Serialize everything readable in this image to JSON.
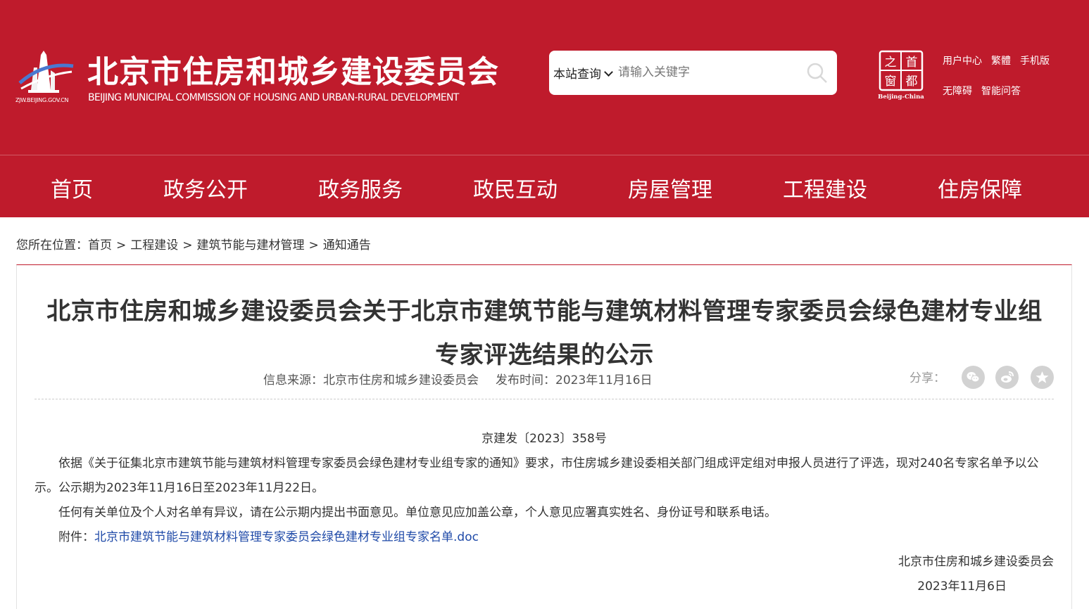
{
  "header": {
    "logo_url_text": "ZJW.BEIJING.GOV.CN",
    "site_title": "北京市住房和城乡建设委员会",
    "site_subtitle": "BEIJING MUNICIPAL COMMISSION OF HOUSING AND URBAN-RURAL DEVELOPMENT",
    "search": {
      "scope_label": "本站查询",
      "placeholder": "请输入关键字"
    },
    "capital_logo": {
      "chars": [
        "之",
        "首",
        "窗",
        "都"
      ],
      "caption": "Beijing-China"
    },
    "links_row1": [
      "用户中心",
      "繁體",
      "手机版"
    ],
    "links_row2": [
      "无障碍",
      "智能问答"
    ]
  },
  "nav": [
    "首页",
    "政务公开",
    "政务服务",
    "政民互动",
    "房屋管理",
    "工程建设",
    "住房保障"
  ],
  "breadcrumb": {
    "prefix": "您所在位置：",
    "items": [
      "首页",
      "工程建设",
      "建筑节能与建材管理",
      "通知通告"
    ],
    "separator": ">"
  },
  "article": {
    "title_line1": "北京市住房和城乡建设委员会关于北京市建筑节能与建筑材料管理专家委员会绿色建材专业组",
    "title_line2": "专家评选结果的公示",
    "source": "信息来源：北京市住房和城乡建设委员会",
    "publish_time": "发布时间：2023年11月16日",
    "share_label": "分享：",
    "share_icons": [
      "wechat-icon",
      "weibo-icon",
      "star-icon"
    ],
    "doc_number": "京建发〔2023〕358号",
    "paragraph1": "依据《关于征集北京市建筑节能与建筑材料管理专家委员会绿色建材专业组专家的通知》要求，市住房城乡建设委相关部门组成评定组对申报人员进行了评选，现对240名专家名单予以公示。公示期为2023年11月16日至2023年11月22日。",
    "paragraph2": "任何有关单位及个人对名单有异议，请在公示期内提出书面意见。单位意见应加盖公章，个人意见应署真实姓名、身份证号和联系电话。",
    "attachment_label": "附件：",
    "attachment_link": "北京市建筑节能与建筑材料管理专家委员会绿色建材专业组专家名单.doc",
    "signature": "北京市住房和城乡建设委员会",
    "signature_date": "2023年11月6日"
  },
  "colors": {
    "brand_red": "#bf1b2c",
    "link_blue": "#1f4aa8",
    "share_gray": "#d2d2d2"
  }
}
